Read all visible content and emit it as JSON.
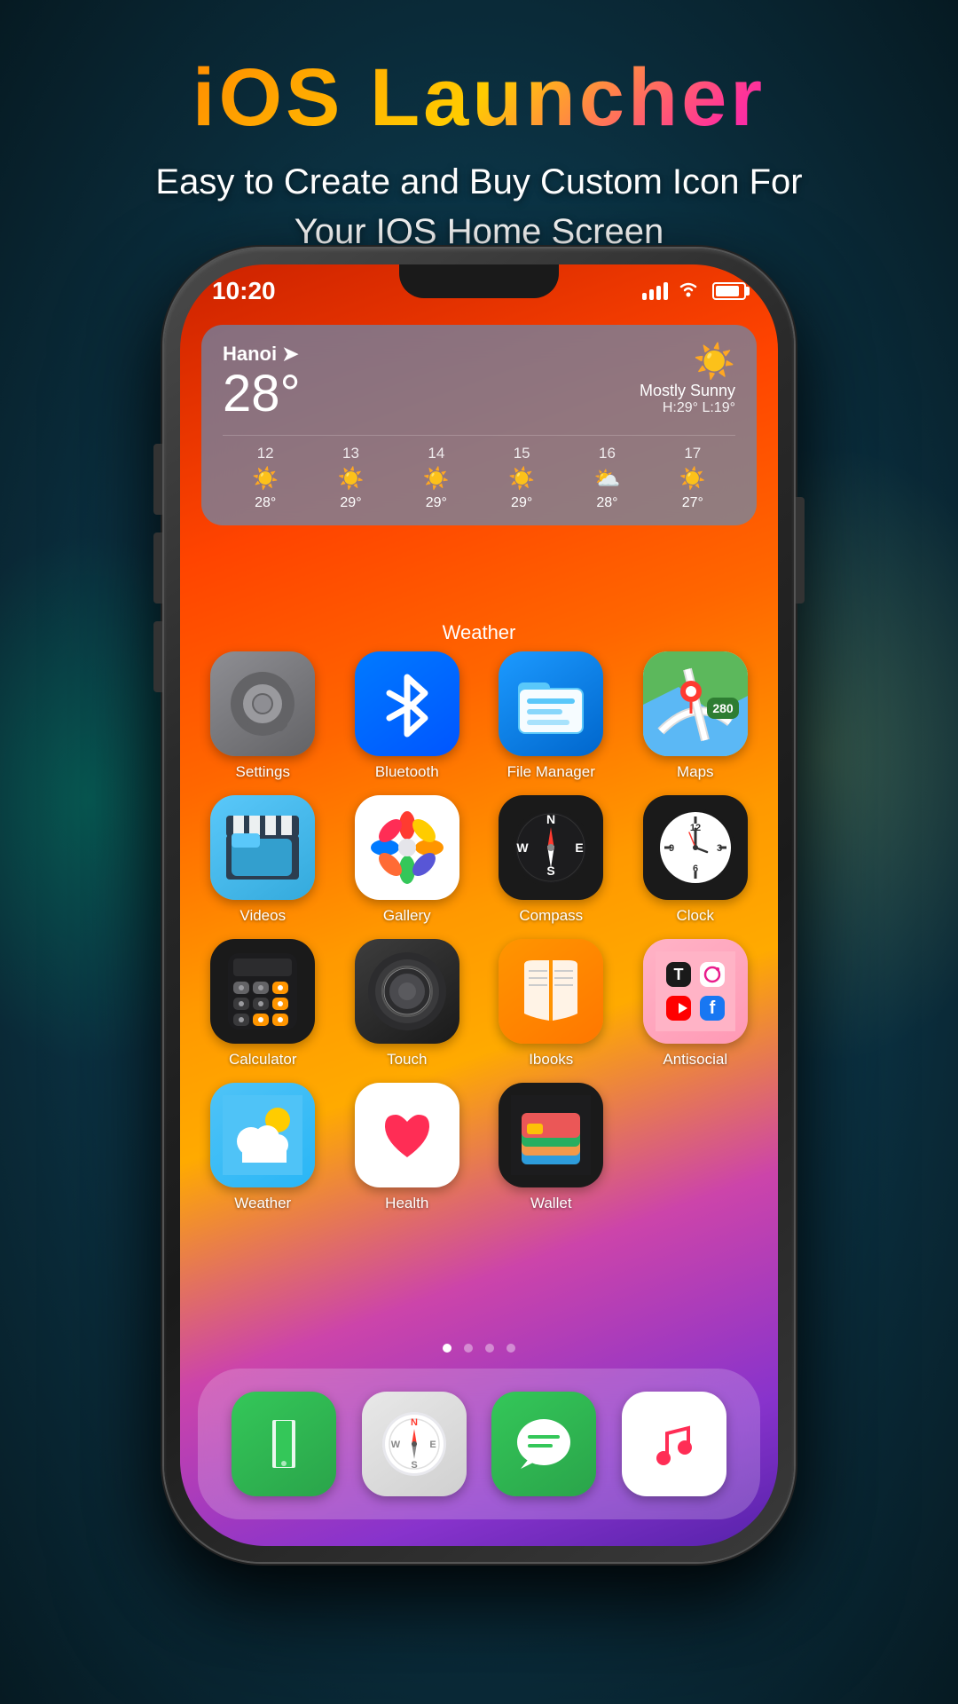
{
  "title": {
    "main": "iOS Launcher",
    "subtitle": "Easy to Create and Buy Custom Icon For\nYour IOS Home Screen"
  },
  "status_bar": {
    "time": "10:20",
    "signal_bars": 4,
    "wifi": true,
    "battery": 75
  },
  "weather_widget": {
    "city": "Hanoi",
    "temperature": "28°",
    "condition": "Mostly Sunny",
    "high": "H:29°",
    "low": "L:19°",
    "forecast": [
      {
        "day": "12",
        "icon": "☀️",
        "temp": "28°"
      },
      {
        "day": "13",
        "icon": "☀️",
        "temp": "29°"
      },
      {
        "day": "14",
        "icon": "☀️",
        "temp": "29°"
      },
      {
        "day": "15",
        "icon": "☀️",
        "temp": "29°"
      },
      {
        "day": "16",
        "icon": "⛅",
        "temp": "28°"
      },
      {
        "day": "17",
        "icon": "☀️",
        "temp": "27°"
      }
    ]
  },
  "section_label": "Weather",
  "apps": [
    {
      "id": "settings",
      "label": "Settings"
    },
    {
      "id": "bluetooth",
      "label": "Bluetooth"
    },
    {
      "id": "filemanager",
      "label": "File Manager"
    },
    {
      "id": "maps",
      "label": "Maps"
    },
    {
      "id": "videos",
      "label": "Videos"
    },
    {
      "id": "gallery",
      "label": "Gallery"
    },
    {
      "id": "compass",
      "label": "Compass"
    },
    {
      "id": "clock",
      "label": "Clock"
    },
    {
      "id": "calculator",
      "label": "Calculator"
    },
    {
      "id": "touch",
      "label": "Touch"
    },
    {
      "id": "ibooks",
      "label": "Ibooks"
    },
    {
      "id": "antisocial",
      "label": "Antisocial"
    },
    {
      "id": "weather",
      "label": "Weather"
    },
    {
      "id": "health",
      "label": "Health"
    },
    {
      "id": "wallet",
      "label": "Wallet"
    }
  ],
  "dock": [
    {
      "id": "phone",
      "label": "Phone"
    },
    {
      "id": "safari",
      "label": "Safari"
    },
    {
      "id": "messages",
      "label": "Messages"
    },
    {
      "id": "music",
      "label": "Music"
    }
  ],
  "page_dots": [
    true,
    false,
    false,
    false
  ]
}
